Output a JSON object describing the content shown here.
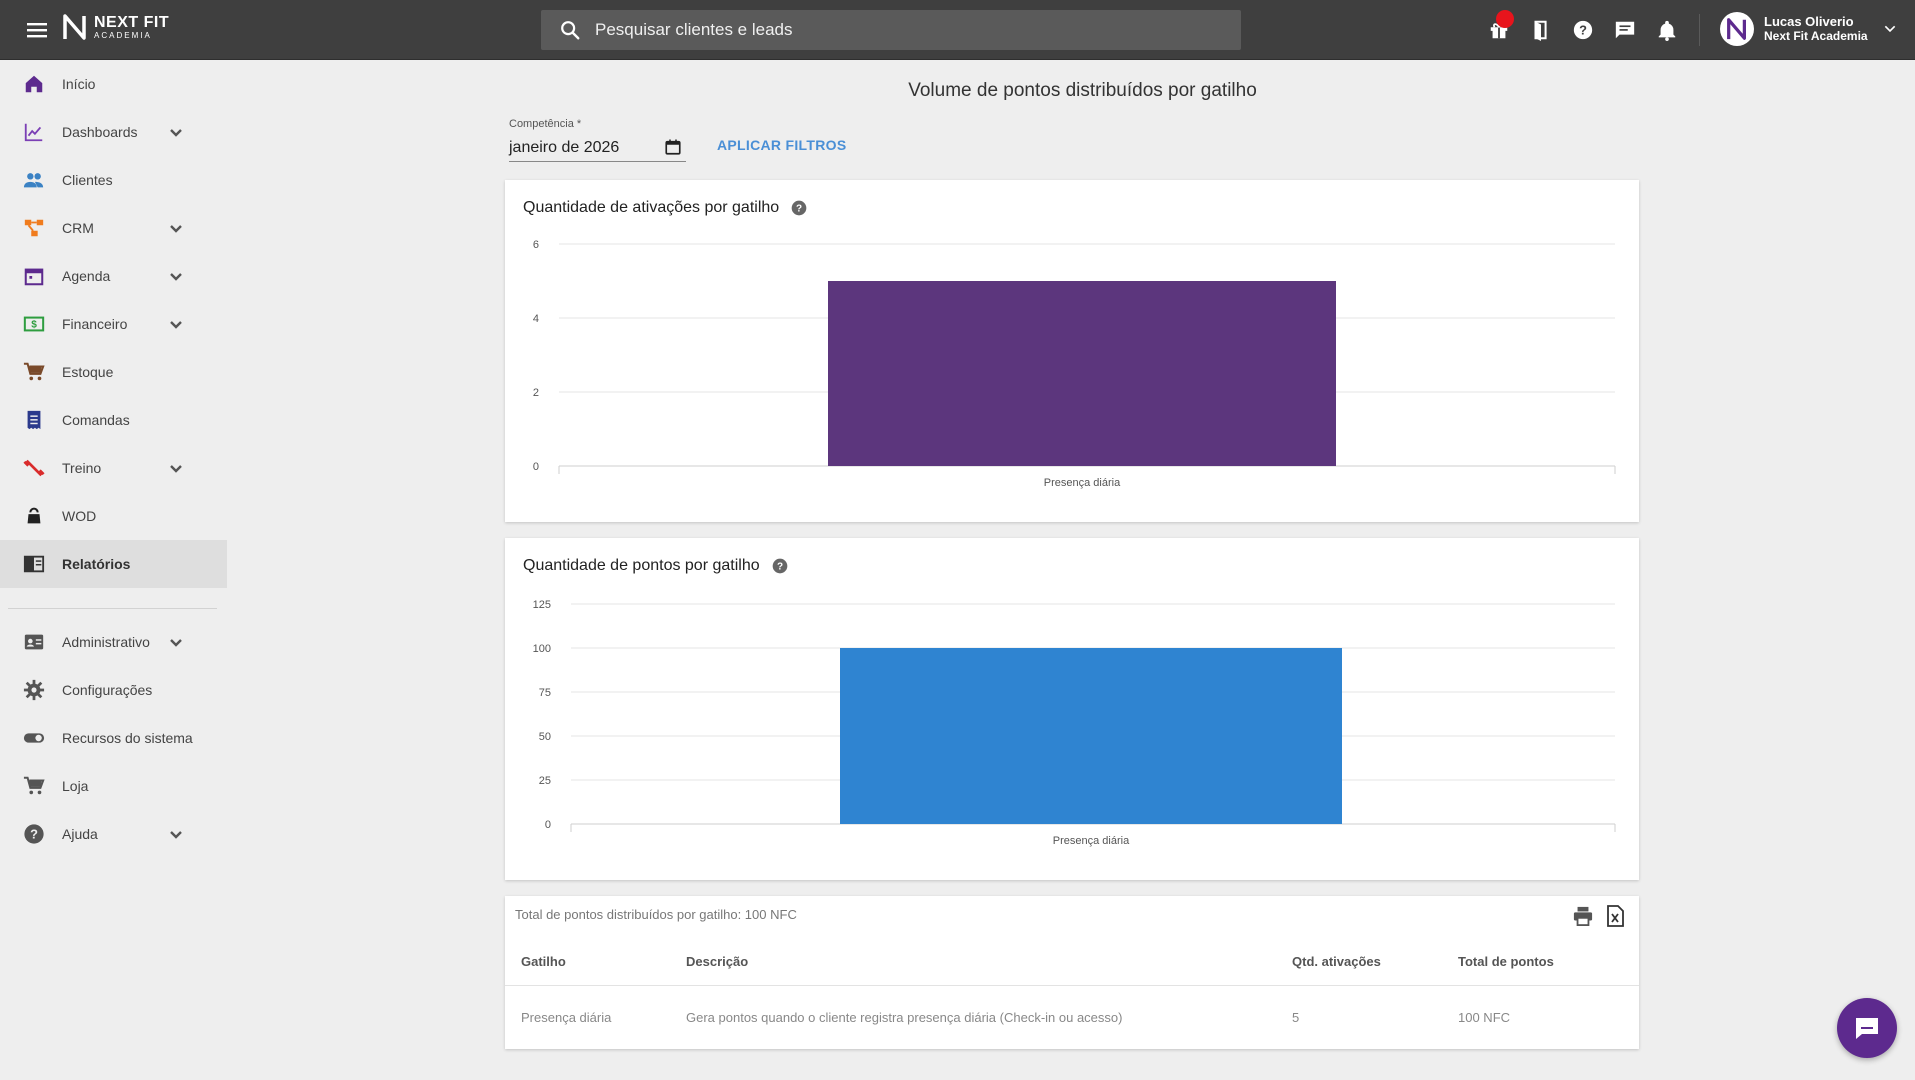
{
  "app": {
    "logo_main": "NEXT FIT",
    "logo_sub": "ACADEMIA"
  },
  "search": {
    "placeholder": "Pesquisar clientes e leads"
  },
  "user": {
    "name": "Lucas Oliverio",
    "org": "Next Fit Academia"
  },
  "sidebar": {
    "items": [
      {
        "label": "Início",
        "icon": "home-icon",
        "color": "#5d2a8e"
      },
      {
        "label": "Dashboards",
        "icon": "chart-line-icon",
        "color": "#7b3fb5",
        "expandable": true
      },
      {
        "label": "Clientes",
        "icon": "people-icon",
        "color": "#3b82c4"
      },
      {
        "label": "CRM",
        "icon": "crm-icon",
        "color": "#f07c1e",
        "expandable": true
      },
      {
        "label": "Agenda",
        "icon": "calendar-icon",
        "color": "#5d2a8e",
        "expandable": true
      },
      {
        "label": "Financeiro",
        "icon": "money-icon",
        "color": "#2e9d3f",
        "expandable": true
      },
      {
        "label": "Estoque",
        "icon": "cart-icon",
        "color": "#7a4a2a"
      },
      {
        "label": "Comandas",
        "icon": "receipt-icon",
        "color": "#2b3a8c"
      },
      {
        "label": "Treino",
        "icon": "dumbbell-icon",
        "color": "#d92b2b",
        "expandable": true
      },
      {
        "label": "WOD",
        "icon": "kettlebell-icon",
        "color": "#222222"
      },
      {
        "label": "Relatórios",
        "icon": "reports-icon",
        "color": "#333333",
        "active": true
      },
      {
        "label": "Administrativo",
        "icon": "id-card-icon",
        "color": "#555555",
        "expandable": true
      },
      {
        "label": "Configurações",
        "icon": "gear-icon",
        "color": "#555555"
      },
      {
        "label": "Recursos do sistema",
        "icon": "toggle-icon",
        "color": "#555555"
      },
      {
        "label": "Loja",
        "icon": "cart-icon",
        "color": "#555555"
      },
      {
        "label": "Ajuda",
        "icon": "help-icon",
        "color": "#555555",
        "expandable": true
      }
    ]
  },
  "main": {
    "title": "Volume de pontos distribuídos por gatilho",
    "filter": {
      "label": "Competência *",
      "value": "janeiro de 2026",
      "apply_label": "APLICAR FILTROS"
    }
  },
  "chart_data": [
    {
      "type": "bar",
      "title": "Quantidade de ativações por gatilho",
      "categories": [
        "Presença diária"
      ],
      "values": [
        5
      ],
      "ylim": [
        0,
        6
      ],
      "yticks": [
        0,
        2,
        4,
        6
      ],
      "color": "#5c367d",
      "grid": true
    },
    {
      "type": "bar",
      "title": "Quantidade de pontos por gatilho",
      "categories": [
        "Presença diária"
      ],
      "values": [
        100
      ],
      "ylim": [
        0,
        125
      ],
      "yticks": [
        0,
        25,
        50,
        75,
        100,
        125
      ],
      "color": "#2f84d1",
      "grid": true
    }
  ],
  "table": {
    "summary": "Total de pontos distribuídos por gatilho: 100 NFC",
    "headers": [
      "Gatilho",
      "Descrição",
      "Qtd. ativações",
      "Total de pontos"
    ],
    "rows": [
      [
        "Presença diária",
        "Gera pontos quando o cliente registra presença diária (Check-in ou acesso)",
        "5",
        "100 NFC"
      ]
    ]
  }
}
